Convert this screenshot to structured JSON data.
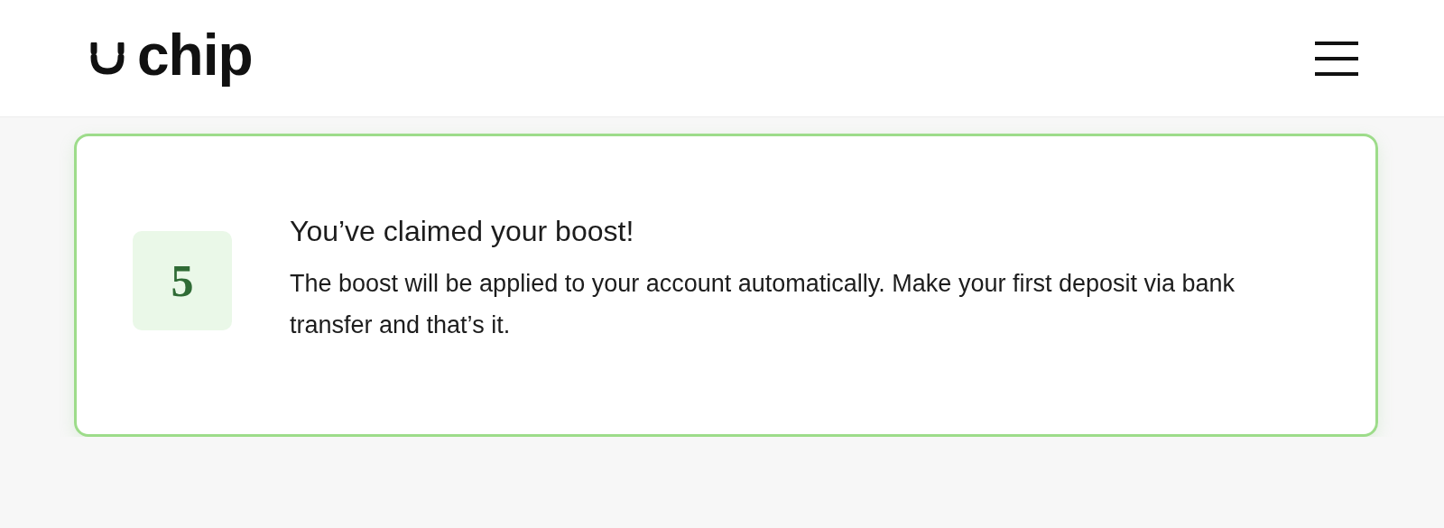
{
  "header": {
    "logo": {
      "text": "chip"
    }
  },
  "card": {
    "badge": "5",
    "title": "You’ve claimed your boost!",
    "body": "The boost will be applied to your account automatically. Make your first deposit via bank transfer and that’s it."
  }
}
